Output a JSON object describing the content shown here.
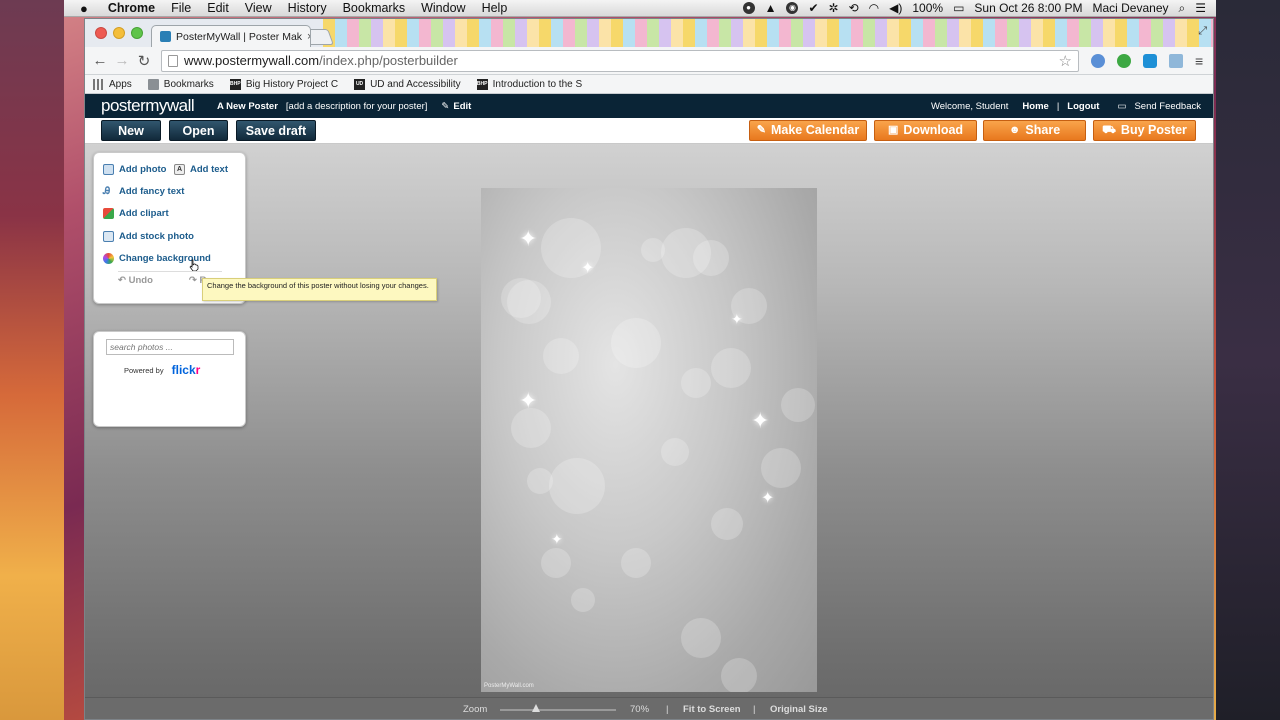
{
  "menubar": {
    "app": "Chrome",
    "items": [
      "File",
      "Edit",
      "View",
      "History",
      "Bookmarks",
      "Window",
      "Help"
    ],
    "battery": "100%",
    "datetime": "Sun Oct 26  8:00 PM",
    "user": "Maci Devaney"
  },
  "browser": {
    "tab_title": "PosterMyWall | Poster Mak",
    "url_domain": "www.postermywall.com",
    "url_path": "/index.php/posterbuilder",
    "bookmarks": [
      "Apps",
      "Bookmarks",
      "Big History Project C",
      "UD and Accessibility",
      "Introduction to the S"
    ]
  },
  "header": {
    "logo": "postermywall",
    "poster_name": "A New Poster",
    "description_placeholder": "[add a description for your poster]",
    "edit_label": "Edit",
    "welcome": "Welcome, Student",
    "home": "Home",
    "separator": "|",
    "logout": "Logout",
    "feedback": "Send Feedback"
  },
  "actions": {
    "new": "New",
    "open": "Open",
    "save_draft": "Save draft",
    "make_calendar": "Make Calendar",
    "download": "Download",
    "share": "Share",
    "buy_poster": "Buy Poster"
  },
  "tools": {
    "add_photo": "Add photo",
    "add_text": "Add text",
    "add_fancy_text": "Add fancy text",
    "add_clipart": "Add clipart",
    "add_stock_photo": "Add stock photo",
    "change_background": "Change background",
    "undo": "Undo",
    "redo": "R"
  },
  "tooltip": "Change the background of this poster without losing your changes.",
  "photo_search": {
    "placeholder": "search photos ...",
    "powered_by": "Powered by",
    "flickr_a": "flick",
    "flickr_b": "r"
  },
  "poster": {
    "watermark": "PosterMyWall.com"
  },
  "zoom": {
    "label": "Zoom",
    "value": "70%",
    "fit": "Fit to Screen",
    "original": "Original Size",
    "level": 0.7
  }
}
